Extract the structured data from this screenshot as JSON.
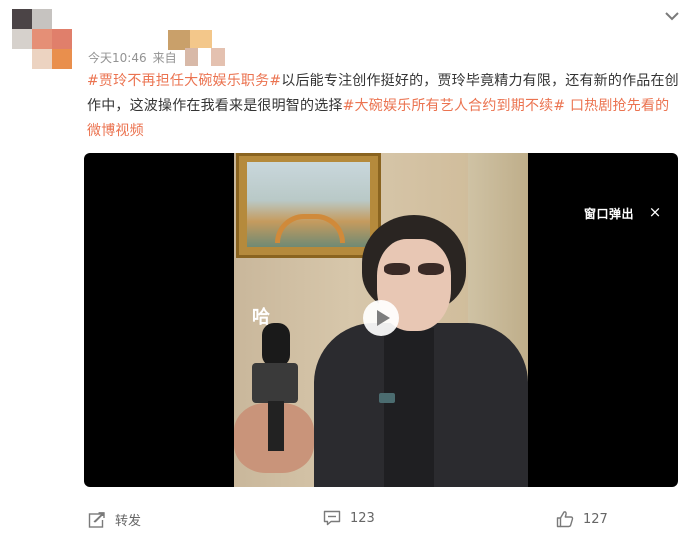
{
  "post": {
    "meta_time": "今天10:46",
    "meta_source": "来自",
    "text_segments": [
      {
        "text": "#贾玲不再担任大碗娱乐职务#",
        "type": "tag"
      },
      {
        "text": "以后能专注创作挺好的，贾玲毕竟精力有限，还有新的作品在创作中，这波操作在我看来是很明智的选择",
        "type": "text"
      },
      {
        "text": "#大碗娱乐所有艺人合约到期不续#",
        "type": "tag"
      },
      {
        "text": " ",
        "type": "text"
      },
      {
        "text": "口热剧抢先看的微博视频",
        "type": "link"
      }
    ]
  },
  "video": {
    "popout_label": "窗口弹出",
    "close_symbol": "×",
    "mic_logo": "哈"
  },
  "actions": {
    "repost_label": "转发",
    "comment_count": "123",
    "like_count": "127"
  },
  "colors": {
    "accent": "#eb7350",
    "meta": "#939393",
    "icon": "#7a7a7a"
  },
  "icons": [
    "chevron-down-icon",
    "share-icon",
    "comment-icon",
    "like-icon",
    "play-icon",
    "close-icon"
  ]
}
